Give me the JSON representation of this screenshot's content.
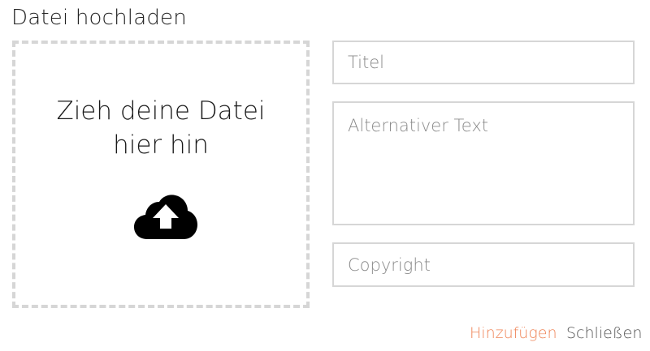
{
  "dialog": {
    "title": "Datei hochladen"
  },
  "dropzone": {
    "text": "Zieh deine Datei hier hin",
    "icon": "cloud-upload-icon"
  },
  "form": {
    "title_placeholder": "Titel",
    "title_value": "",
    "alt_text_placeholder": "Alternativer Text",
    "alt_text_value": "",
    "copyright_placeholder": "Copyright",
    "copyright_value": ""
  },
  "actions": {
    "add_label": "Hinzufügen",
    "close_label": "Schließen"
  },
  "colors": {
    "accent": "#ef8558",
    "border": "#d6d6d6",
    "text": "#222222"
  }
}
